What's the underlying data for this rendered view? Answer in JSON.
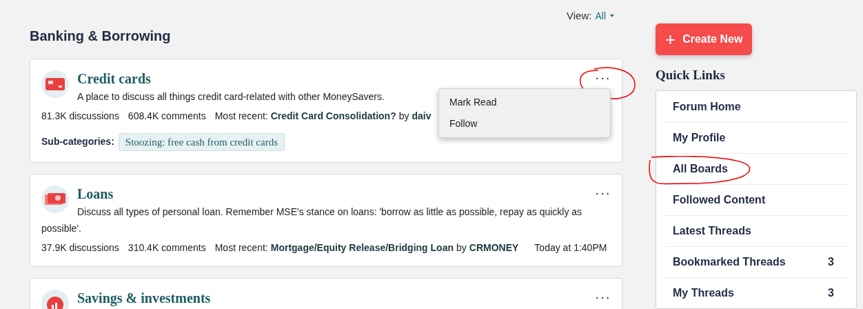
{
  "view": {
    "label": "View:",
    "value": "All"
  },
  "section_title": "Banking & Borrowing",
  "categories": [
    {
      "kind": "card",
      "title": "Credit cards",
      "description": "A place to discuss all things credit card-related with other MoneySavers.",
      "discussions": "81.3K discussions",
      "comments": "608.4K comments",
      "recent_label": "Most recent:",
      "recent_thread": "Credit Card Consolidation?",
      "by": "by",
      "recent_user": "daiv",
      "subcategories_label": "Sub-categories:",
      "subcategories": [
        "Stoozing: free cash from credit cards"
      ],
      "more": "···",
      "menu": [
        "Mark Read",
        "Follow"
      ]
    },
    {
      "kind": "loan",
      "title": "Loans",
      "description": "Discuss all types of personal loan. Remember MSE's stance on loans: 'borrow as little as possible, repay as quickly as possible'.",
      "discussions": "37.9K discussions",
      "comments": "310.4K comments",
      "recent_label": "Most recent:",
      "recent_thread": "Mortgage/Equity Release/Bridging Loan",
      "by": "by",
      "recent_user": "CRMONEY",
      "recent_time": "Today at 1:40PM",
      "more": "···"
    },
    {
      "kind": "savings",
      "title": "Savings & investments",
      "more": "···"
    }
  ],
  "create_button": {
    "icon": "+",
    "label": "Create New"
  },
  "quick_links": {
    "title": "Quick Links",
    "items": [
      {
        "label": "Forum Home"
      },
      {
        "label": "My Profile"
      },
      {
        "label": "All Boards"
      },
      {
        "label": "Followed Content"
      },
      {
        "label": "Latest Threads"
      },
      {
        "label": "Bookmarked Threads",
        "count": "3"
      },
      {
        "label": "My Threads",
        "count": "3"
      }
    ]
  }
}
